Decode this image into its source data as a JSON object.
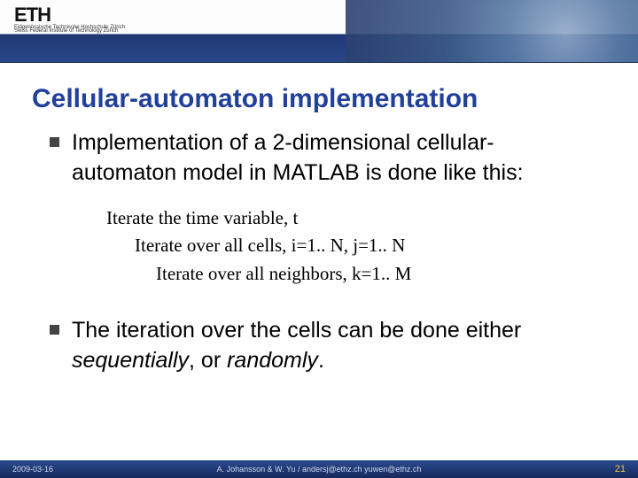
{
  "header": {
    "logo_main": "ETH",
    "logo_sub1": "Eidgenössische Technische Hochschule Zürich",
    "logo_sub2": "Swiss Federal Institute of Technology Zurich"
  },
  "title": "Cellular-automaton implementation",
  "bullet1": "Implementation of a 2-dimensional cellular-automaton model in MATLAB is done like this:",
  "pseudo": {
    "l1": "Iterate the time variable, t",
    "l2": "Iterate over all cells, i=1.. N, j=1.. N",
    "l3": "Iterate over all neighbors, k=1.. M"
  },
  "bullet2_a": "The iteration over the cells can be done either ",
  "bullet2_seq": "sequentially",
  "bullet2_or": ", or ",
  "bullet2_rand": "randomly",
  "bullet2_end": ".",
  "footer": {
    "date": "2009-03-16",
    "author": "A. Johansson & W. Yu / andersj@ethz.ch yuwen@ethz.ch",
    "page": "21"
  }
}
